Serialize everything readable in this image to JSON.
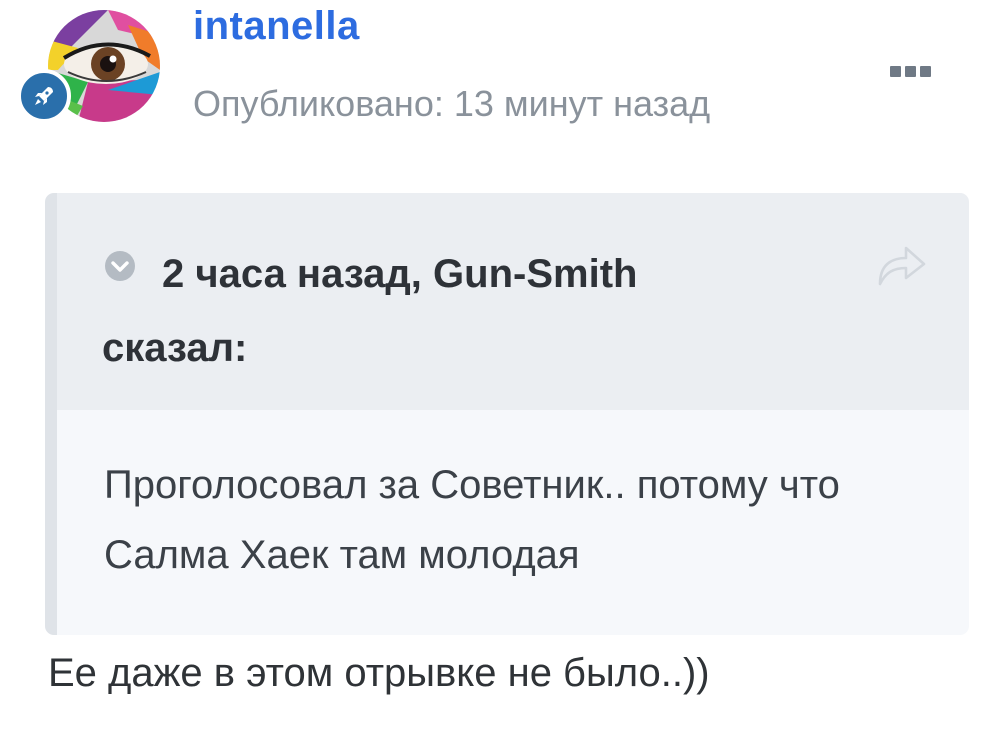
{
  "author": {
    "name": "intanella",
    "avatar_icon": "eye-avatar",
    "badge_icon": "rocket-icon"
  },
  "post_meta": {
    "published": "Опубликовано: 13 минут назад",
    "more_icon": "ellipsis-icon"
  },
  "quote": {
    "citation_line1": "2 часа назад, Gun-Smith",
    "citation_line2": "сказал:",
    "text": "Проголосовал за Советник.. потому что Салма Хаек там молодая",
    "toggle_icon": "chevron-down-icon",
    "share_icon": "share-arrow-icon"
  },
  "post": {
    "text": "Ее даже в этом отрывке не было..))"
  },
  "colors": {
    "author_link": "#2d6ce0",
    "meta_text": "#8a929b",
    "badge": "#2a6fab",
    "quote_header_bg": "#ebeef2",
    "quote_body_bg": "#f6f8fb"
  }
}
